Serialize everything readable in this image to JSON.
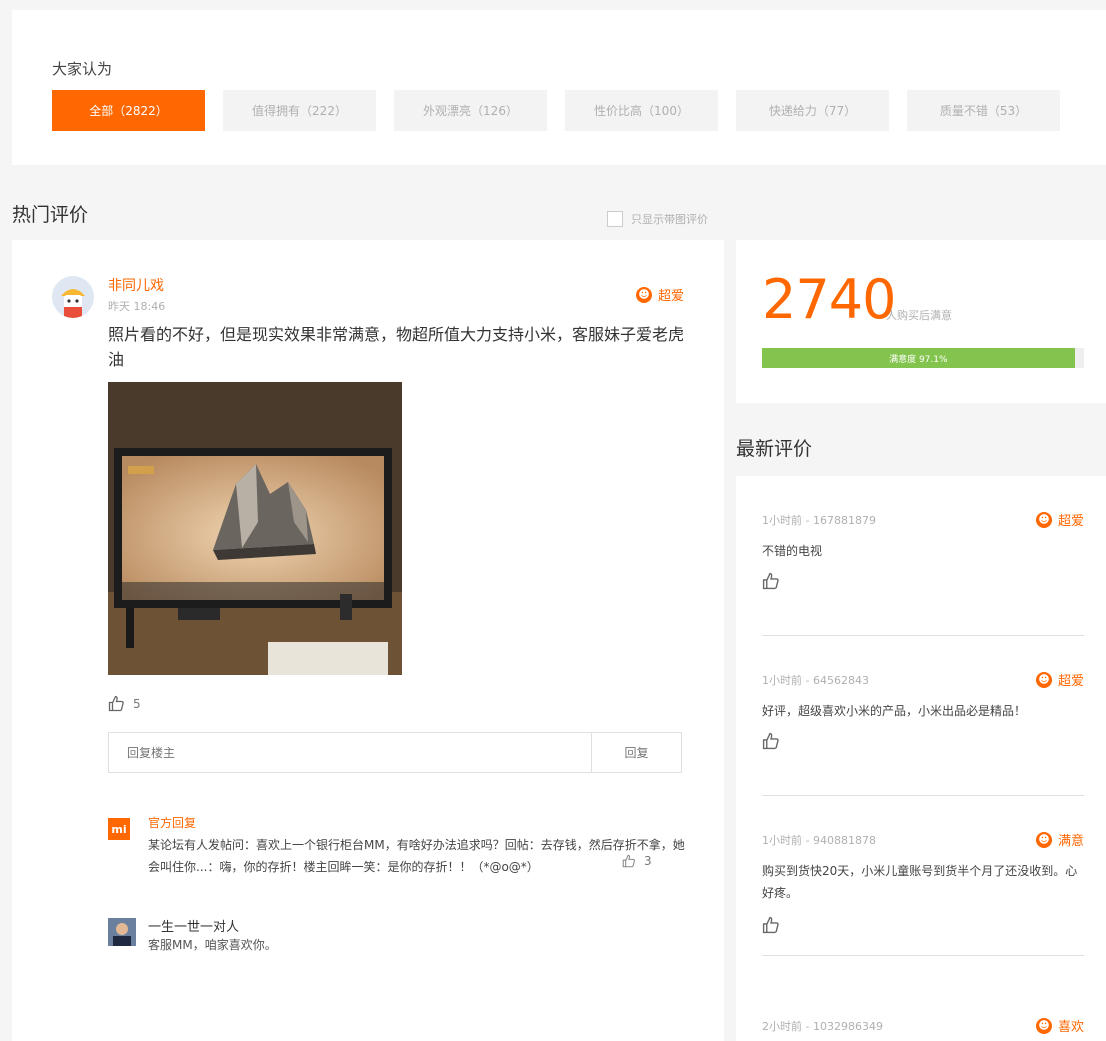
{
  "filters": {
    "heading": "大家认为",
    "tabs": [
      {
        "label": "全部（2822）"
      },
      {
        "label": "值得拥有（222）"
      },
      {
        "label": "外观漂亮（126）"
      },
      {
        "label": "性价比高（100）"
      },
      {
        "label": "快递给力（77）"
      },
      {
        "label": "质量不错（53）"
      }
    ]
  },
  "hot_reviews": {
    "heading": "热门评价",
    "pic_only_label": "只显示带图评价"
  },
  "main_review": {
    "username": "非同儿戏",
    "time": "昨天 18:46",
    "rating": "超爱",
    "text": "照片看的不好，但是现实效果非常满意，物超所值大力支持小米，客服妹子爱老虎油",
    "likes": "5",
    "reply_placeholder": "回复楼主",
    "reply_button": "回复",
    "official_reply": {
      "logo": "mi",
      "label": "官方回复",
      "text": "某论坛有人发帖问：喜欢上一个银行柜台MM，有啥好办法追求吗？回帖：去存钱，然后存折不拿，她会叫住你...：嗨，你的存折！楼主回眸一笑：是你的存折！！（*@o@*）",
      "likes": "3"
    },
    "sub_comment": {
      "name": "一生一世一对人",
      "text": "客服MM，咱家喜欢你。"
    }
  },
  "stats": {
    "count": "2740",
    "label": "人购买后满意",
    "satisfaction_text": "满意度 97.1%",
    "satisfaction": 0.971
  },
  "latest_reviews": {
    "heading": "最新评价",
    "items": [
      {
        "meta": "1小时前 - 167881879",
        "rating": "超爱",
        "text": "不错的电视"
      },
      {
        "meta": "1小时前 - 64562843",
        "rating": "超爱",
        "text": "好评，超级喜欢小米的产品，小米出品必是精品！"
      },
      {
        "meta": "1小时前 - 940881878",
        "rating": "满意",
        "text": "购买到货快20天，小米儿童账号到货半个月了还没收到。心好疼。"
      },
      {
        "meta": "2小时前 - 1032986349",
        "rating": "喜欢",
        "text": ""
      }
    ]
  }
}
